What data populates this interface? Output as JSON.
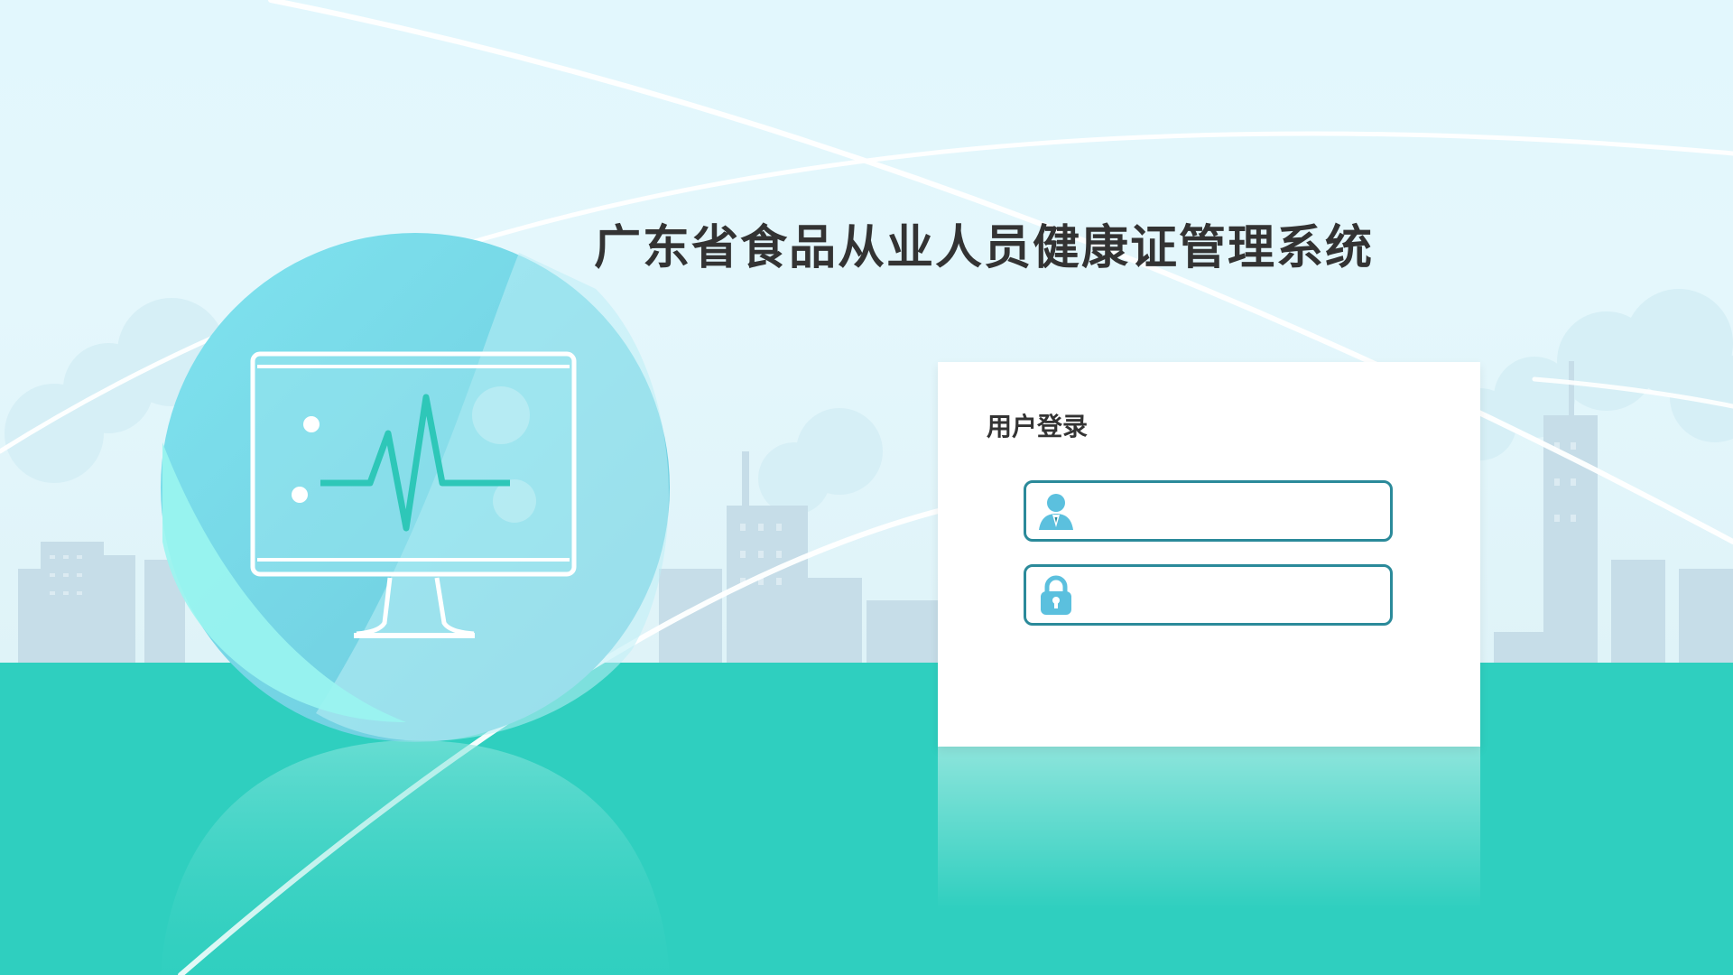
{
  "app": {
    "title": "广东省食品从业人员健康证管理系统"
  },
  "login": {
    "heading": "用户登录",
    "username": {
      "value": "",
      "placeholder": ""
    },
    "password": {
      "value": "",
      "placeholder": ""
    }
  },
  "icons": {
    "illustration": "monitor-heartbeat-icon",
    "username": "user-icon",
    "password": "lock-icon"
  },
  "colors": {
    "ground": "#2fcfbf",
    "field_border": "#2b8a9a",
    "icon_blue": "#5bc0de",
    "title_text": "#333333"
  }
}
